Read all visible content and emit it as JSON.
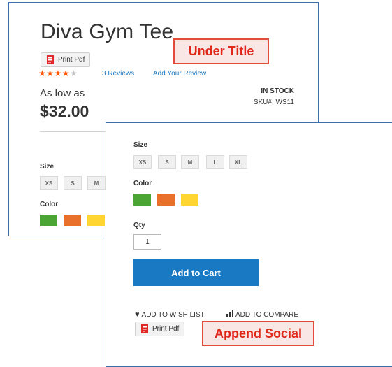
{
  "product": {
    "title": "Diva Gym Tee",
    "rating_fraction": 0.8,
    "reviews_link": "3 Reviews",
    "add_review_link": "Add Your Review",
    "price_prefix": "As low as",
    "price": "$32.00",
    "stock_status": "IN STOCK",
    "sku": "SKU#:  WS11"
  },
  "print_pdf_label": "Print Pdf",
  "options": {
    "size_label": "Size",
    "sizes": [
      "XS",
      "S",
      "M",
      "L",
      "XL"
    ],
    "color_label": "Color",
    "colors": [
      "#4aa535",
      "#e8702a",
      "#ffd532"
    ],
    "qty_label": "Qty",
    "qty_value": "1"
  },
  "actions": {
    "add_to_cart": "Add to Cart",
    "wish_list": "ADD TO WISH LIST",
    "compare": "ADD TO COMPARE"
  },
  "callouts": {
    "under_title": "Under Title",
    "append_social": "Append Social"
  },
  "colors": {
    "panel_border": "#3d6ea5",
    "accent": "#1979c3",
    "star": "#ff5501",
    "callout_border": "#e34c3c",
    "callout_text": "#e0281a"
  }
}
